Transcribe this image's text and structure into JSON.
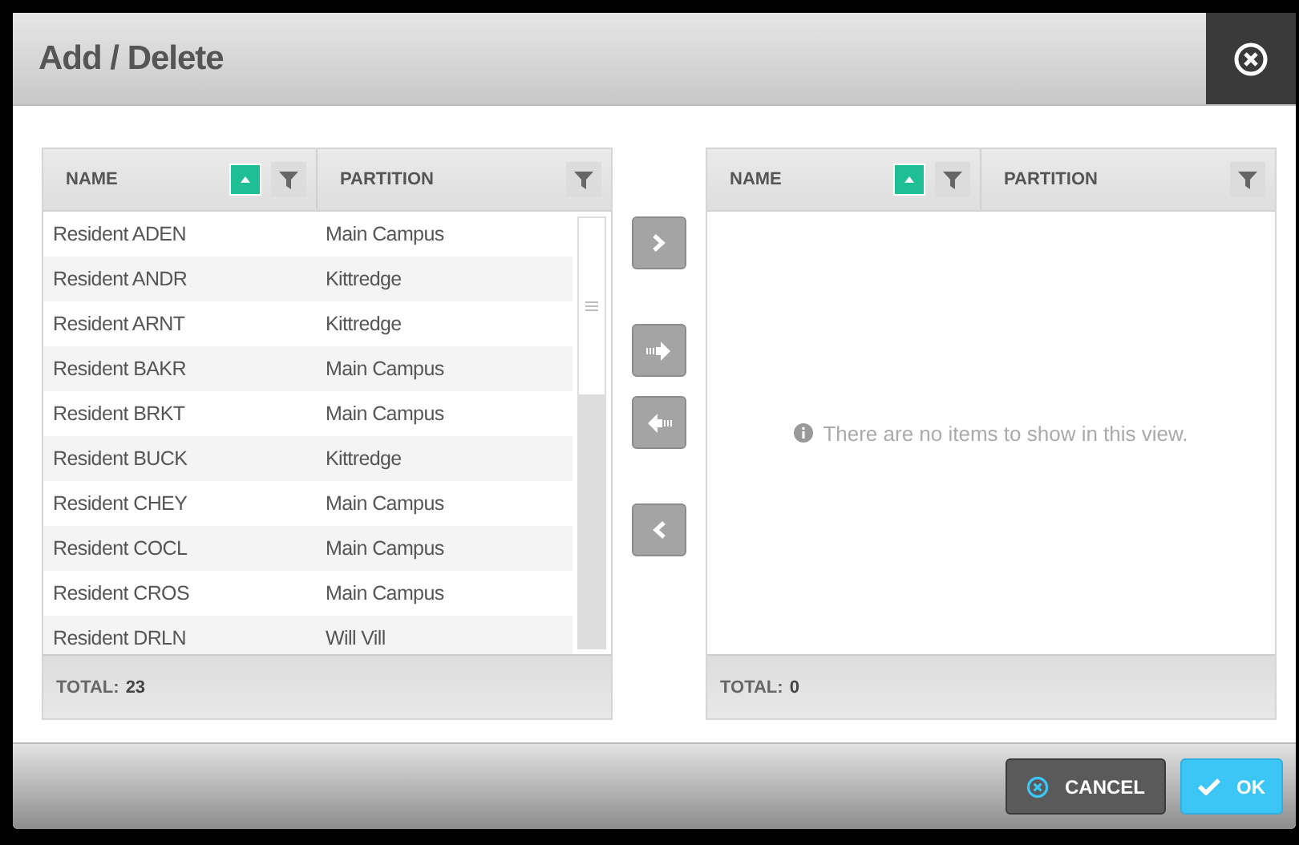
{
  "dialog": {
    "title": "Add / Delete"
  },
  "available": {
    "columns": [
      {
        "label": "NAME",
        "sorted": true
      },
      {
        "label": "PARTITION",
        "sorted": false
      }
    ],
    "rows": [
      {
        "name": "Resident ADEN",
        "partition": "Main Campus"
      },
      {
        "name": "Resident ANDR",
        "partition": "Kittredge"
      },
      {
        "name": "Resident ARNT",
        "partition": "Kittredge"
      },
      {
        "name": "Resident BAKR",
        "partition": "Main Campus"
      },
      {
        "name": "Resident BRKT",
        "partition": "Main Campus"
      },
      {
        "name": "Resident BUCK",
        "partition": "Kittredge"
      },
      {
        "name": "Resident CHEY",
        "partition": "Main Campus"
      },
      {
        "name": "Resident COCL",
        "partition": "Main Campus"
      },
      {
        "name": "Resident CROS",
        "partition": "Main Campus"
      },
      {
        "name": "Resident DRLN",
        "partition": "Will Vill"
      }
    ],
    "total_label": "TOTAL:",
    "total": "23"
  },
  "transfer_buttons": [
    {
      "kind": "add"
    },
    {
      "kind": "add_all"
    },
    {
      "kind": "remove_all"
    },
    {
      "kind": "remove"
    }
  ],
  "selected": {
    "columns": [
      {
        "label": "NAME",
        "sorted": true
      },
      {
        "label": "PARTITION",
        "sorted": false
      }
    ],
    "empty_message": "There are no items to show in this view.",
    "total_label": "TOTAL:",
    "total": "0"
  },
  "buttons": [
    {
      "kind": "cancel",
      "label": "CANCEL"
    },
    {
      "kind": "ok",
      "label": "OK"
    }
  ]
}
